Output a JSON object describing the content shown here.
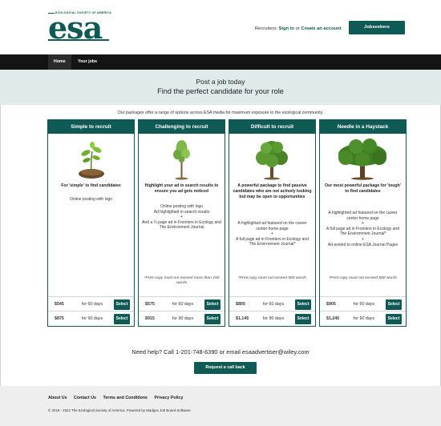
{
  "header": {
    "logo_text": "esa",
    "logo_org": "ECOLOGICAL SOCIETY OF AMERICA",
    "recruiters_label": "Recruiters:",
    "sign_in": "Sign in",
    "or_text": "or",
    "create_account": "Create an account",
    "jobseekers_label": "Jobseekers"
  },
  "nav": {
    "items": [
      {
        "label": "Home"
      },
      {
        "label": "Your jobs"
      }
    ]
  },
  "hero": {
    "title": "Post a job today",
    "subtitle": "Find the perfect candidate for your role"
  },
  "intro": "Our packages offer a range of options across ESA media for maximum exposure to the ecological community.",
  "packages": [
    {
      "name": "Simple to recruit",
      "description": "For 'simple' to find candidates",
      "features": [
        "Online posting with logo"
      ],
      "note": "",
      "prices": [
        {
          "price": "$545",
          "duration": "for 60 days",
          "select_label": "Select"
        },
        {
          "price": "$875",
          "duration": "for 90 days",
          "select_label": "Select"
        }
      ]
    },
    {
      "name": "Challenging to recruit",
      "description": "Highlight your ad in search results to ensure you ad gets noticed",
      "features": [
        "Online posting with logo",
        "Ad highlighted in search results",
        "+",
        "And a ¼ page ad in Frontiers in Ecology and The Environment Journal"
      ],
      "note": "*Print copy must not exceed more than 250 words",
      "prices": [
        {
          "price": "$575",
          "duration": "for 60 days",
          "select_label": "Select"
        },
        {
          "price": "$915",
          "duration": "for 90 days",
          "select_label": "Select"
        }
      ]
    },
    {
      "name": "Difficult to recruit",
      "description": "A powerful package to find passive candidates who are not actively looking but may be open to opportunities",
      "features": [
        "A highlighted ad featured on the career center home page",
        "+",
        "A full page ad in Frontiers in Ecology and The Environment Journal*"
      ],
      "note": "*Print copy must not exceed 500 words",
      "prices": [
        {
          "price": "$805",
          "duration": "for 60 days",
          "select_label": "Select"
        },
        {
          "price": "$1,145",
          "duration": "for 90 days",
          "select_label": "Select"
        }
      ]
    },
    {
      "name": "Needle in a Haystack",
      "description": "Our most powerful package for 'tough' to find candidates",
      "features": [
        "A highlighted ad featured on the career center home page",
        "+",
        "A full page ad in Frontiers in Ecology and The Environment Journal*",
        "+",
        "Ad posted to online ESA Journal Pages"
      ],
      "note": "*Print copy must not exceed 500 words",
      "prices": [
        {
          "price": "$905",
          "duration": "for 60 days",
          "select_label": "Select"
        },
        {
          "price": "$1,245",
          "duration": "for 90 days",
          "select_label": "Select"
        }
      ]
    }
  ],
  "help": {
    "text": "Need help? Call 1-201-748-6390 or email esaadvertiser@wiley.com",
    "callback_label": "Request a call back"
  },
  "footer": {
    "links": [
      {
        "label": "About Us"
      },
      {
        "label": "Contact Us"
      },
      {
        "label": "Terms and Conditions"
      },
      {
        "label": "Privacy Policy"
      }
    ],
    "copyright": "© 2019 - 2022 The Ecological Society of America. Powered by Madgex Job Board Software"
  },
  "colors": {
    "brand": "#0f5a54",
    "nav_bg": "#141414",
    "hero_bg": "#dfeaea",
    "footer_bg": "#eeeeee"
  }
}
